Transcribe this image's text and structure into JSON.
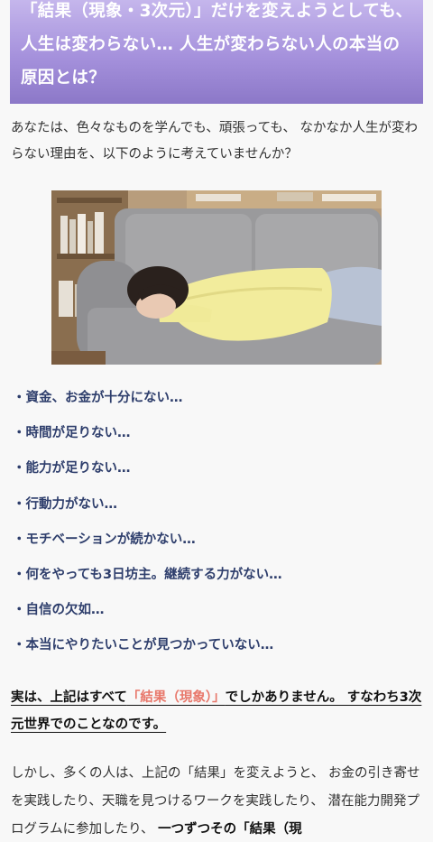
{
  "header": {
    "title": "「結果（現象・3次元）」だけを変えようとしても、人生は変わらない… 人生が変わらない人の本当の原因とは？"
  },
  "intro": "あなたは、色々なものを学んでも、頑張っても、 なかなか人生が変わらない理由を、以下のように考えていませんか？",
  "bullets": [
    "・資金、お金が十分にない…",
    "・時間が足りない…",
    "・能力が足りない…",
    "・行動力がない…",
    "・モチベーションが続かない…",
    "・何をやっても3日坊主。継続する力がない…",
    "・自信の欠如…",
    "・本当にやりたいことが見つかっていない…"
  ],
  "highlight": {
    "part1": "実は、上記はすべて",
    "emphasis": "「結果（現象）」",
    "part2": "でしかありません。 すなわち3次元世界でのことなのです。"
  },
  "body2": {
    "text": "しかし、多くの人は、上記の「結果」を変えようと、 お金の引き寄せを実践したり、天職を見つけるワークを実践したり、 潜在能力開発プログラムに参加したり、 ",
    "strong": "一つずつその「結果（現"
  }
}
